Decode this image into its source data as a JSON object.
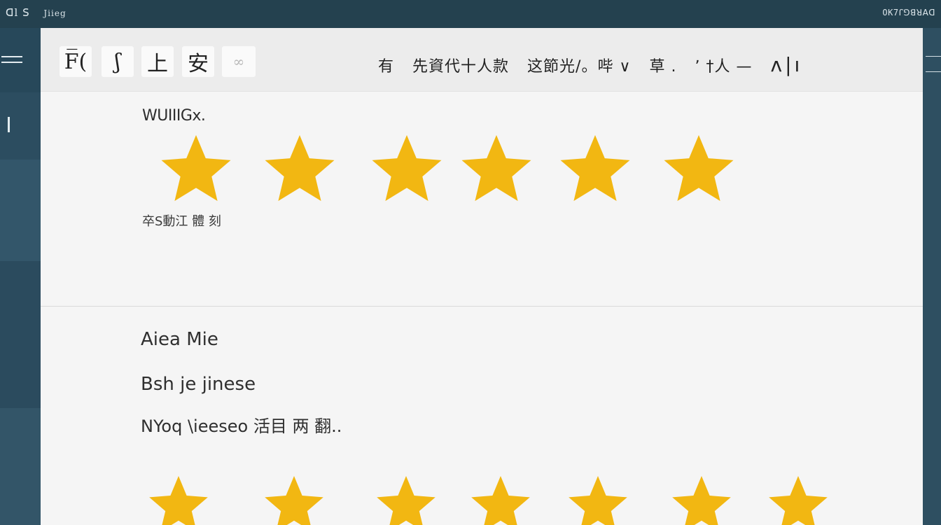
{
  "statusbar": {
    "left_text": "ꓷl ꓢ",
    "left_sub": "Jiieg",
    "right_text": "OK7ꓩꓨꓭꓤꓮꓷ"
  },
  "toolbar": {
    "tools": [
      {
        "label": "F̅(",
        "icon": "format-icon"
      },
      {
        "label": "ʃ",
        "icon": "link-icon"
      },
      {
        "label": "上",
        "icon": "text-icon"
      },
      {
        "label": "安",
        "icon": "style-icon"
      },
      {
        "label": "∞",
        "icon": "more-icon"
      }
    ],
    "nav": [
      "有",
      "先資代十人款",
      "这節光/。哔 ∨",
      "草 .",
      "ʼ †人 —",
      "ʿ— ǀ|ı"
    ],
    "nav_tail": "ʌ|ı"
  },
  "rating_section": {
    "label": "WUIIIGx.",
    "star_count": 6,
    "rating": 6,
    "caption": "卒S動江  體 刻"
  },
  "review": {
    "author": "Aiea Mie",
    "title": "Bsh je jinese",
    "body": "NYoq \\ieeseo 活目 两 翻..",
    "star_count": 7,
    "rating": 7
  },
  "colors": {
    "star": "#f2b712",
    "panel_bg": "#f5f5f5",
    "frame": "#2a4a5c"
  }
}
